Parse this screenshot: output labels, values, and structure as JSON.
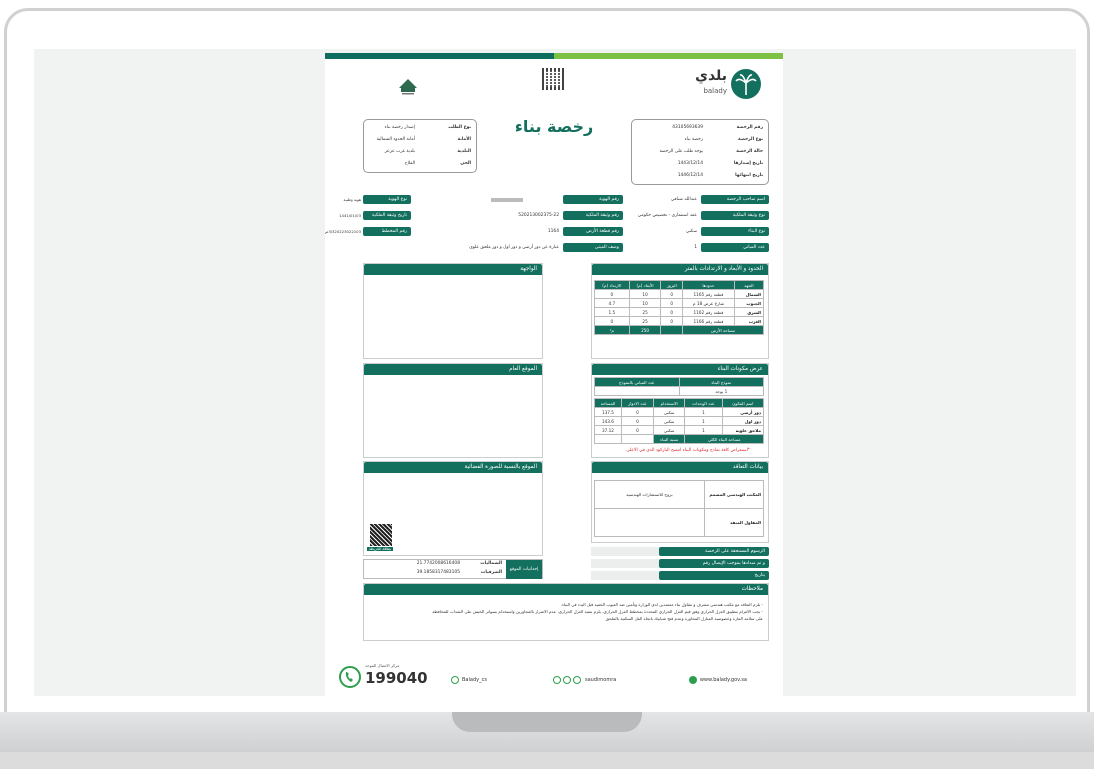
{
  "header": {
    "brand_ar": "بلدي",
    "brand_en": "balady",
    "title": "رخصة بناء"
  },
  "license": [
    {
      "label": "رقم الرخصة",
      "value": "43105693639"
    },
    {
      "label": "نوع الرخصة",
      "value": "رخصة بناء"
    },
    {
      "label": "حالة الرخصة",
      "value": "يوجد طلب على الرخصة"
    },
    {
      "label": "تاريخ إصدارها",
      "value": "1443/12/14"
    },
    {
      "label": "تاريخ انتهائها",
      "value": "1446/12/14"
    }
  ],
  "request": [
    {
      "label": "نوع الطلب",
      "value": "إصدار رخصة بناء"
    },
    {
      "label": "الأمانة",
      "value": "أمانة الحدود الشمالية"
    },
    {
      "label": "البلدية",
      "value": "بلدية غرب عرعر"
    },
    {
      "label": "الحي",
      "value": "الفلاح"
    }
  ],
  "owner": {
    "rows_right": [
      {
        "label": "اسم صاحب الرخصة",
        "value": "عبدالله شنافي"
      },
      {
        "label": "نوع وثيقة الملكية",
        "value": "عقد استثماري - تخصيص حكومي"
      },
      {
        "label": "نوع البناء",
        "value": "سكني"
      },
      {
        "label": "عدد المباني",
        "value": "1"
      }
    ],
    "rows_mid": [
      {
        "label": "رقم الهوية",
        "value": ""
      },
      {
        "label": "رقم وثيقة الملكية",
        "value": "520213002375-22"
      },
      {
        "label": "رقم قطعة الأرض",
        "value": "1164"
      },
      {
        "label": "وصف المبنى",
        "value": "عبارة عن دور أرضي و دور اول و دور ملحق علوي"
      }
    ],
    "rows_left": [
      {
        "label": "نوع الهوية",
        "value": "هوية وطنية"
      },
      {
        "label": "تاريخ وثيقة الملكية",
        "value": "1441/01/03"
      },
      {
        "label": "رقم المخطط",
        "value": "3/320223022103ص/المعدل"
      }
    ]
  },
  "borders": {
    "title": "الحدود و الأبعاد و الارتدادات بالمتر",
    "headers": [
      "الجهة",
      "حدودها",
      "البروز",
      "الأبعاد (م)",
      "الارتداد (م)"
    ],
    "rows": [
      [
        "الشمال",
        "قطعة رقم 1165",
        "0",
        "10",
        "0"
      ],
      [
        "الجنوب",
        "شارع عرض 18 م",
        "0",
        "10",
        "4.7"
      ],
      [
        "الشرق",
        "قطعة رقم 1162",
        "0",
        "25",
        "1.5"
      ],
      [
        "الغرب",
        "قطعة رقم 1166",
        "0",
        "25",
        "0"
      ]
    ],
    "area_label": "مساحة الأرض",
    "area_value": "250",
    "area_unit": "م²"
  },
  "facade": {
    "title": "الواجهة"
  },
  "components": {
    "title": "عرض مكونات البناء",
    "model_label": "نموذج البناء",
    "count_label": "عدد المباني بالنموذج",
    "model_value": "1 يوجد",
    "headers": [
      "اسم المكون",
      "عدد الوحدات",
      "الاستخدام",
      "عدد الادوار",
      "المساحة"
    ],
    "rows": [
      [
        "دور أرضي",
        "1",
        "سكني",
        "0",
        "137.5"
      ],
      [
        "دور اول",
        "1",
        "سكني",
        "0",
        "143.6"
      ],
      [
        "ملاحق علوية",
        "1",
        "سكني",
        "0",
        "37.12"
      ]
    ],
    "total_label": "مساحة البناء الكلي",
    "ratio_label": "نسبة البناء",
    "note": "*استعراض كافة نماذج ومكونات البناء امسح الباركود الذي في الاعلى"
  },
  "general_site": {
    "title": "الموقع العام"
  },
  "satellite": {
    "title": "الموقع بالنسبة للصورة الفضائية",
    "qr_caption": "بطاقة الخريطة"
  },
  "contract": {
    "title": "بيانات التعاقد",
    "designer_label": "المكتب الهندسي المصمم",
    "designer_value": "بروج للاستشارات الهندسية",
    "contractor_label": "المقاول المنفذ",
    "contractor_value": ""
  },
  "fees": [
    {
      "label": "الرسوم المستحقة على الرخصة"
    },
    {
      "label": "و تم سدادها بموجب الإيصال رقم"
    },
    {
      "label": "بتاريخ"
    }
  ],
  "coords": {
    "label": "إحداثيات الموقع",
    "north_label": "الشماليات",
    "north": "21.7742008616408",
    "east_label": "الشرقيات",
    "east": "39.1858317483105"
  },
  "notes": {
    "title": "ملاحظات",
    "lines": [
      "- يلزم التعاقد مع مكتب هندسي مشرف و مقاول بناء معتمدين لدى الوزارة وتأمين ضد العيوب الخفية قبل البدء في البناء.",
      "- يجب الالتزام بتطبيق العزل الحراري وفق قيم العزل الحراري المحددة بمخطط العزل الحراري، يلزم تنفيذ العزل الحراري، عدم الاضرار بالمجاورين واستخدام بسواتر الخيش على الشدات للمحافظة",
      "على سلامة المارة وخصوصية المنازل المجاورة وعدم فتح شبابيك باتجاه الفل السكنية بالملحق"
    ]
  },
  "footer": {
    "website": "www.balady.gov.sa",
    "social": "saudimomra",
    "twitter": "Balady_cs",
    "callcenter_label": "مركز الاتصال الموحد",
    "phone": "199040"
  },
  "colors": {
    "teal": "#14705e",
    "green": "#7cc143"
  }
}
